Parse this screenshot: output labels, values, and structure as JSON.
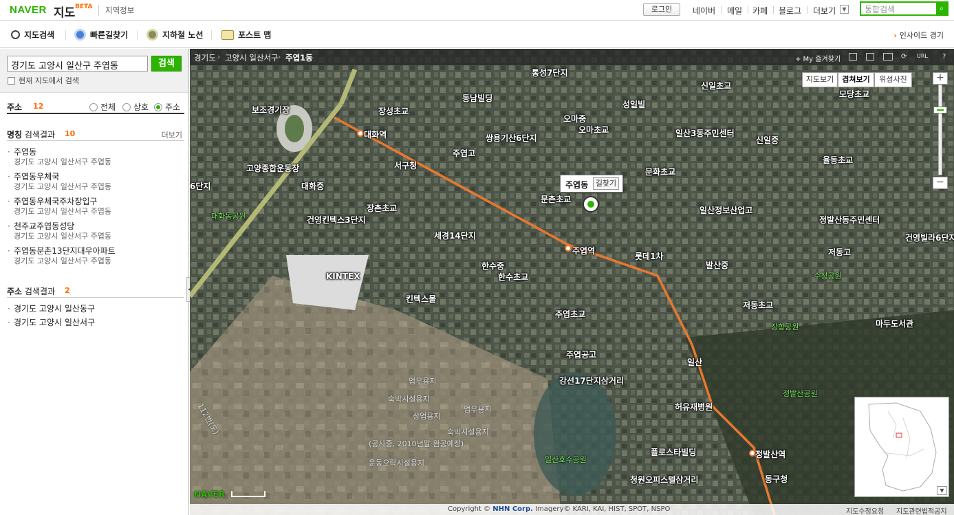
{
  "topbar": {
    "logo": "NAVER",
    "map_title": "지도",
    "beta": "BETA",
    "local_info": "지역정보",
    "login": "로그인",
    "nav": [
      "네이버",
      "메일",
      "카페",
      "블로그",
      "더보기"
    ],
    "search_placeholder": "통합검색"
  },
  "toolbar": {
    "tools": [
      "지도검색",
      "빠른길찾기",
      "지하철 노선",
      "포스트 맵"
    ],
    "insight": "인사이드 경기"
  },
  "left": {
    "query": "경기도 고양시 일산구 주엽동",
    "search_button": "검색",
    "current_map_label": "현재 지도에서 검색",
    "filter_label": "주소",
    "filter_count": "12",
    "radios": [
      "전체",
      "상호",
      "주소"
    ],
    "selected_radio": "주소",
    "name_section": {
      "title_bold": "명칭",
      "title_rest": " 검색결과",
      "count": "10",
      "more": "더보기"
    },
    "name_results": [
      {
        "name": "주엽동",
        "addr": "경기도 고양시 일산서구 주엽동"
      },
      {
        "name": "주엽동우체국",
        "addr": "경기도 고양시 일산서구 주엽동"
      },
      {
        "name": "주엽동우체국주차장입구",
        "addr": "경기도 고양시 일산서구 주엽동"
      },
      {
        "name": "천주교주엽동성당",
        "addr": "경기도 고양시 일산서구 주엽동"
      },
      {
        "name": "주엽동문촌13단지대우아파트",
        "addr": "경기도 고양시 일산서구 주엽동"
      }
    ],
    "addr_section": {
      "title_bold": "주소",
      "title_rest": " 검색결과",
      "count": "2"
    },
    "addr_results": [
      "경기도 고양시 일산동구",
      "경기도 고양시 일산서구"
    ]
  },
  "map": {
    "breadcrumb": [
      "경기도",
      "고양시 일산서구",
      "주엽1동"
    ],
    "favorites": "+ My 즐겨찾기",
    "url_label": "URL",
    "view_buttons": [
      "지도보기",
      "겹쳐보기",
      "위성사진"
    ],
    "active_view": "겹쳐보기",
    "popup_title": "주엽동",
    "popup_button": "길찾기",
    "labels_white": [
      "통성7단지",
      "신일초교",
      "동남빌딩",
      "성일빌",
      "장성초교",
      "오마중",
      "오마초교",
      "보조경기장",
      "대화역",
      "쌍용기산6단지",
      "주엽고",
      "일산3동주민센터",
      "신일중",
      "모당초교",
      "서구청",
      "율동초교",
      "고양종합운동장",
      "문화초교",
      "대화중",
      "문촌초교",
      "장촌초교",
      "일산정보산업고",
      "정발산동주민센터",
      "건영킨텍스3단지",
      "세경14단지",
      "주엽역",
      "롯데1차",
      "발산중",
      "저동고",
      "건영빌라6단지",
      "KINTEX",
      "한수중",
      "한수초교",
      "킨텍스몰",
      "주엽초교",
      "저동초교",
      "마두도서관",
      "주엽공고",
      "일산",
      "강선17단지삼거리",
      "허유재병원",
      "플로스타빌딩",
      "정발산역",
      "동구청",
      "청원오피스텔삼거리",
      "6단지"
    ],
    "labels_green": [
      "대화동공원",
      "수정공원",
      "장항공원",
      "정발산공원",
      "일산호수공원"
    ],
    "labels_dim": [
      "업무용지",
      "숙박시설용지",
      "상업용지",
      "업무용지",
      "숙박시설용지",
      "(공사중, 2010년말 완공예정)",
      "운동오락시설용지",
      "112번(도)"
    ],
    "copyright_prefix": "Copyright ©",
    "copyright_corp": "NHN Corp.",
    "copyright_rest": "Imagery© KARI, KAI, HIST, SPOT, NSPO",
    "footer_links": [
      "지도수정요청",
      "지도관련법적공지"
    ],
    "watermark": "NAVER",
    "colors": {
      "brand": "#2db400",
      "accent": "#ff6a00",
      "subway": "#e8782e"
    }
  }
}
